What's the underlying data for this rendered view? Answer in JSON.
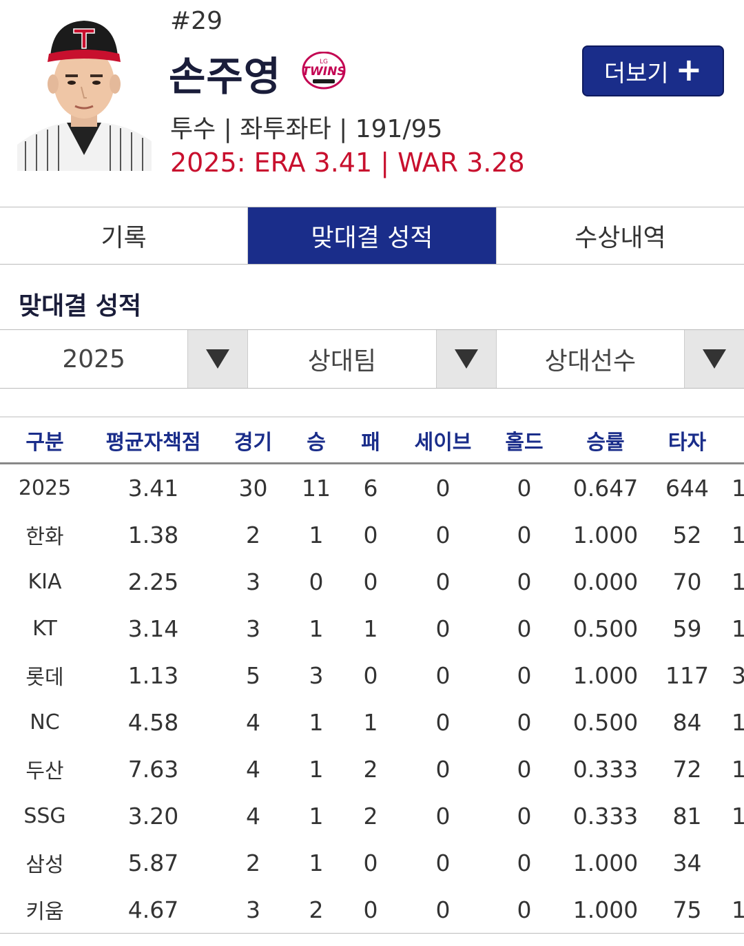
{
  "player": {
    "number": "#29",
    "name": "손주영",
    "team_logo_text": "LG TWINS",
    "info": "투수 | 좌투좌타 | 191/95",
    "season_summary": "2025: ERA 3.41 | WAR 3.28"
  },
  "more_button": {
    "label": "더보기",
    "icon": "plus-icon"
  },
  "tabs": [
    {
      "label": "기록",
      "active": false
    },
    {
      "label": "맞대결 성적",
      "active": true
    },
    {
      "label": "수상내역",
      "active": false
    }
  ],
  "section_title": "맞대결 성적",
  "filters": {
    "year": "2025",
    "opponent_team": "상대팀",
    "opponent_player": "상대선수"
  },
  "table": {
    "headers": [
      "구분",
      "평균자책점",
      "경기",
      "승",
      "패",
      "세이브",
      "홀드",
      "승률",
      "타자"
    ],
    "rows": [
      {
        "label": "2025",
        "era": "3.41",
        "games": "30",
        "wins": "11",
        "losses": "6",
        "saves": "0",
        "holds": "0",
        "win_pct": "0.647",
        "batters": "644",
        "next_col_partial": "1"
      },
      {
        "label": "한화",
        "era": "1.38",
        "games": "2",
        "wins": "1",
        "losses": "0",
        "saves": "0",
        "holds": "0",
        "win_pct": "1.000",
        "batters": "52",
        "next_col_partial": "1"
      },
      {
        "label": "KIA",
        "era": "2.25",
        "games": "3",
        "wins": "0",
        "losses": "0",
        "saves": "0",
        "holds": "0",
        "win_pct": "0.000",
        "batters": "70",
        "next_col_partial": "1"
      },
      {
        "label": "KT",
        "era": "3.14",
        "games": "3",
        "wins": "1",
        "losses": "1",
        "saves": "0",
        "holds": "0",
        "win_pct": "0.500",
        "batters": "59",
        "next_col_partial": "1"
      },
      {
        "label": "롯데",
        "era": "1.13",
        "games": "5",
        "wins": "3",
        "losses": "0",
        "saves": "0",
        "holds": "0",
        "win_pct": "1.000",
        "batters": "117",
        "next_col_partial": "3"
      },
      {
        "label": "NC",
        "era": "4.58",
        "games": "4",
        "wins": "1",
        "losses": "1",
        "saves": "0",
        "holds": "0",
        "win_pct": "0.500",
        "batters": "84",
        "next_col_partial": "1"
      },
      {
        "label": "두산",
        "era": "7.63",
        "games": "4",
        "wins": "1",
        "losses": "2",
        "saves": "0",
        "holds": "0",
        "win_pct": "0.333",
        "batters": "72",
        "next_col_partial": "1"
      },
      {
        "label": "SSG",
        "era": "3.20",
        "games": "4",
        "wins": "1",
        "losses": "2",
        "saves": "0",
        "holds": "0",
        "win_pct": "0.333",
        "batters": "81",
        "next_col_partial": "1"
      },
      {
        "label": "삼성",
        "era": "5.87",
        "games": "2",
        "wins": "1",
        "losses": "0",
        "saves": "0",
        "holds": "0",
        "win_pct": "1.000",
        "batters": "34",
        "next_col_partial": ""
      },
      {
        "label": "키움",
        "era": "4.67",
        "games": "3",
        "wins": "2",
        "losses": "0",
        "saves": "0",
        "holds": "0",
        "win_pct": "1.000",
        "batters": "75",
        "next_col_partial": "1"
      }
    ]
  },
  "colors": {
    "accent_navy": "#1a2d8a",
    "season_red": "#c8102e",
    "team_red": "#c30452"
  }
}
